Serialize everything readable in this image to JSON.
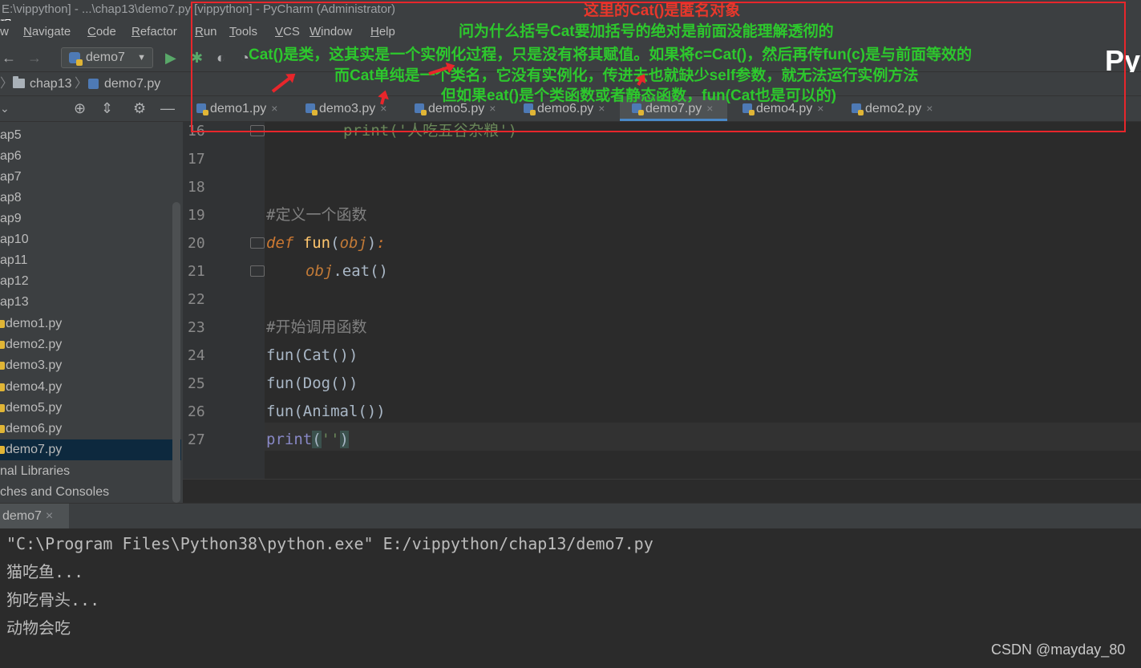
{
  "window": {
    "title": "E:\\vippython] - ...\\chap13\\demo7.py [vippython] - PyCharm (Administrator)",
    "left_fragment": "现",
    "logo_text": "Py"
  },
  "menu": {
    "items": [
      {
        "label": "w",
        "mnemonic": ""
      },
      {
        "label": "avigate",
        "mnemonic": "N"
      },
      {
        "label": "ode",
        "mnemonic": "C"
      },
      {
        "label": "efactor",
        "mnemonic": "R"
      },
      {
        "label": "un",
        "mnemonic": "R"
      },
      {
        "label": "ools",
        "mnemonic": "T"
      },
      {
        "label": "CS",
        "mnemonic": "V"
      },
      {
        "label": "indow",
        "mnemonic": "W"
      },
      {
        "label": "elp",
        "mnemonic": "H"
      }
    ]
  },
  "toolbar": {
    "back_icon": "←",
    "forward_icon": "→",
    "run_config": "demo7",
    "run_icon": "▶",
    "debug_icon": "✱",
    "coverage_icon": "◐",
    "profile_icon": "◔"
  },
  "breadcrumb": {
    "items": [
      "chap13",
      "demo7.py"
    ]
  },
  "project_tree": {
    "items": [
      {
        "label": "ap5",
        "type": "folder",
        "selected": false
      },
      {
        "label": "ap6",
        "type": "folder",
        "selected": false
      },
      {
        "label": "ap7",
        "type": "folder",
        "selected": false
      },
      {
        "label": "ap8",
        "type": "folder",
        "selected": false
      },
      {
        "label": "ap9",
        "type": "folder",
        "selected": false
      },
      {
        "label": "ap10",
        "type": "folder",
        "selected": false
      },
      {
        "label": "ap11",
        "type": "folder",
        "selected": false
      },
      {
        "label": "ap12",
        "type": "folder",
        "selected": false
      },
      {
        "label": "ap13",
        "type": "folder",
        "selected": false
      },
      {
        "label": "demo1.py",
        "type": "file",
        "selected": false
      },
      {
        "label": "demo2.py",
        "type": "file",
        "selected": false
      },
      {
        "label": "demo3.py",
        "type": "file",
        "selected": false
      },
      {
        "label": "demo4.py",
        "type": "file",
        "selected": false
      },
      {
        "label": "demo5.py",
        "type": "file",
        "selected": false
      },
      {
        "label": "demo6.py",
        "type": "file",
        "selected": false
      },
      {
        "label": "demo7.py",
        "type": "file",
        "selected": true
      },
      {
        "label": "nal Libraries",
        "type": "folder",
        "selected": false
      },
      {
        "label": "ches and Consoles",
        "type": "folder",
        "selected": false
      }
    ]
  },
  "tabs": [
    {
      "label": "demo1.py",
      "active": false
    },
    {
      "label": "demo3.py",
      "active": false
    },
    {
      "label": "demo5.py",
      "active": false
    },
    {
      "label": "demo6.py",
      "active": false
    },
    {
      "label": "demo7.py",
      "active": true
    },
    {
      "label": "demo4.py",
      "active": false
    },
    {
      "label": "demo2.py",
      "active": false
    }
  ],
  "code": {
    "line_numbers": [
      "16",
      "17",
      "18",
      "19",
      "20",
      "21",
      "22",
      "23",
      "24",
      "25",
      "26",
      "27"
    ],
    "line16": "print('人吃五谷杂粮')",
    "comment_define": "#定义一个函数",
    "def_kw": "def",
    "func_name": "fun",
    "param": "obj",
    "method": "eat",
    "comment_call": "#开始调用函数",
    "call1_arg": "Cat",
    "call2_arg": "Dog",
    "call3_arg": "Animal",
    "print_fn": "print",
    "print_str": "''"
  },
  "run_panel": {
    "tab_label": "demo7",
    "console_lines": [
      "\"C:\\Program Files\\Python38\\python.exe\" E:/vippython/chap13/demo7.py",
      "猫吃鱼...",
      "狗吃骨头...",
      "动物会吃"
    ]
  },
  "annotations": {
    "line1": "这里的Cat()是匿名对象",
    "line2": "问为什么括号Cat要加括号的绝对是前面没能理解透彻的",
    "line3": "Cat()是类，这其实是一个实例化过程，只是没有将其赋值。如果将c=Cat()，然后再传fun(c)是与前面等效的",
    "line4": "而Cat单纯是一个类名，它没有实例化，传进去也就缺少self参数，就无法运行实例方法",
    "line5": "但如果eat()是个类函数或者静态函数，fun(Cat也是可以的)"
  },
  "watermark": "CSDN @mayday_80",
  "colors": {
    "annotation_red": "#e8262b",
    "annotation_green": "#2dc82d",
    "selection": "#0d293e",
    "active_tab_underline": "#4a88c7"
  }
}
